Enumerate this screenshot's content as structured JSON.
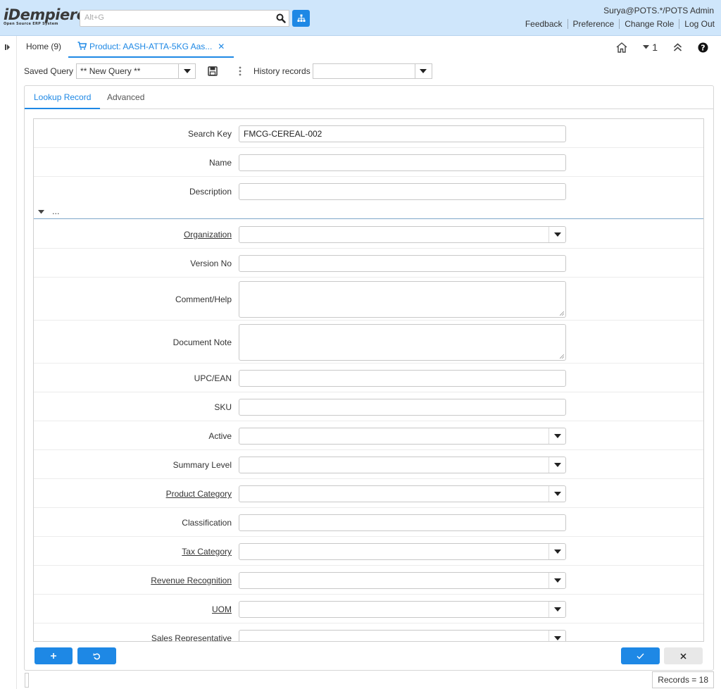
{
  "header": {
    "logo_main": "iDempiere",
    "logo_sub": "Open Source ERP System",
    "search_placeholder": "Alt+G",
    "user": "Surya@POTS.*/POTS Admin",
    "links": [
      "Feedback",
      "Preference",
      "Change Role",
      "Log Out"
    ]
  },
  "tabs": {
    "home": "Home (9)",
    "product": "Product: AASH-ATTA-5KG Aas..."
  },
  "toolbar": {
    "window_count": "1"
  },
  "query": {
    "saved_label": "Saved Query",
    "saved_value": "** New Query **",
    "history_label": "History records",
    "history_value": ""
  },
  "panel_tabs": [
    "Lookup Record",
    "Advanced"
  ],
  "fields": {
    "search_key": {
      "label": "Search Key",
      "value": "FMCG-CEREAL-002"
    },
    "name": {
      "label": "Name",
      "value": ""
    },
    "description": {
      "label": "Description",
      "value": ""
    },
    "collapse_text": "...",
    "organization": {
      "label": "Organization",
      "value": ""
    },
    "version_no": {
      "label": "Version No",
      "value": ""
    },
    "comment_help": {
      "label": "Comment/Help",
      "value": ""
    },
    "document_note": {
      "label": "Document Note",
      "value": ""
    },
    "upc_ean": {
      "label": "UPC/EAN",
      "value": ""
    },
    "sku": {
      "label": "SKU",
      "value": ""
    },
    "active": {
      "label": "Active",
      "value": ""
    },
    "summary_level": {
      "label": "Summary Level",
      "value": ""
    },
    "product_category": {
      "label": "Product Category",
      "value": ""
    },
    "classification": {
      "label": "Classification",
      "value": ""
    },
    "tax_category": {
      "label": "Tax Category",
      "value": ""
    },
    "revenue_recognition": {
      "label": "Revenue Recognition",
      "value": ""
    },
    "uom": {
      "label": "UOM",
      "value": ""
    },
    "sales_rep": {
      "label": "Sales Representative",
      "value": ""
    }
  },
  "status": {
    "records": "Records = 18"
  },
  "colors": {
    "accent": "#1e88e5",
    "header_bg": "#cfe6fb"
  }
}
